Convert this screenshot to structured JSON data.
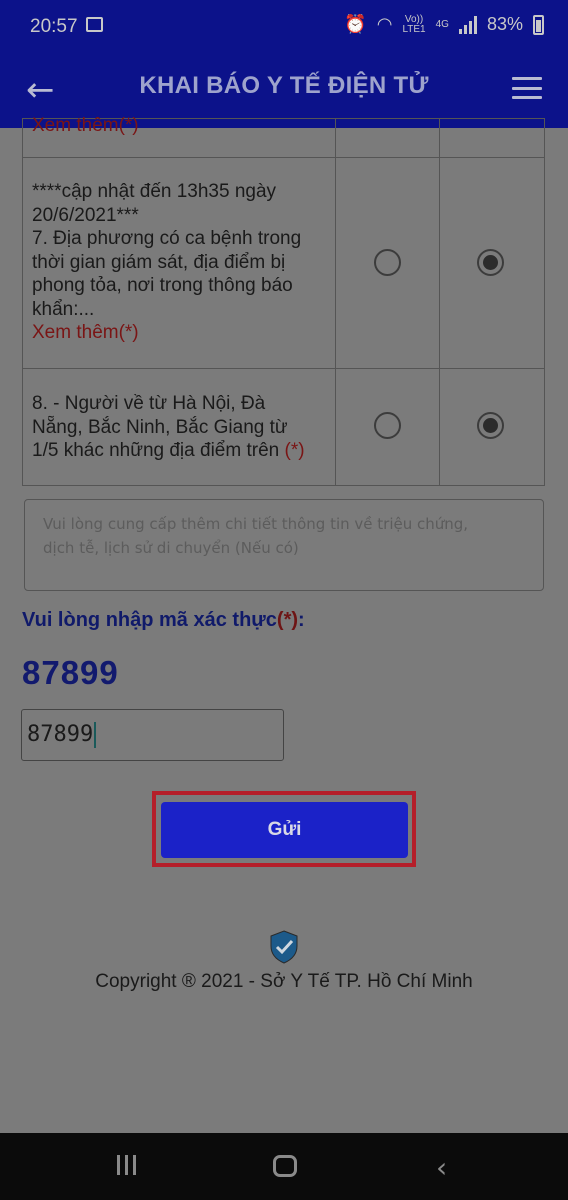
{
  "status_bar": {
    "time": "20:57",
    "volte": "Vo))",
    "lte": "LTE1",
    "network": "4G",
    "battery": "83%"
  },
  "header": {
    "title": "KHAI BÁO Y TẾ ĐIỆN TỬ"
  },
  "questions": [
    {
      "partial_text": "Xem thêm(*)"
    },
    {
      "lines": [
        "****cập nhật đến 13h35 ngày",
        "20/6/2021***",
        "7. Địa phương có ca bệnh trong",
        "thời gian giám sát, địa điểm bị",
        "phong tỏa, nơi trong thông báo",
        "khẩn:..."
      ],
      "more": "Xem thêm(*)",
      "selected": "no"
    },
    {
      "lines": [
        "8. - Người về từ Hà Nội, Đà",
        "Nẵng, Bắc Ninh, Bắc Giang từ"
      ],
      "last_line": "1/5 khác những địa điểm trên",
      "required": "(*)",
      "selected": "no"
    }
  ],
  "details_field": {
    "placeholder_line1": "Vui lòng cung cấp thêm chi tiết thông tin về triệu chứng,",
    "placeholder_line2": "dịch tễ, lịch sử di chuyển (Nếu có)"
  },
  "captcha": {
    "label": "Vui lòng nhập mã xác thực",
    "required": "(*)",
    "suffix": ":",
    "code": "87899",
    "input_value": "87899"
  },
  "submit_label": "Gửi",
  "copyright": "Copyright ® 2021 - Sở Y Tế TP. Hồ Chí Minh",
  "colors": {
    "header_bg": "#0c128a",
    "button_bg": "#1b22c8",
    "highlight": "#b51f2a"
  }
}
